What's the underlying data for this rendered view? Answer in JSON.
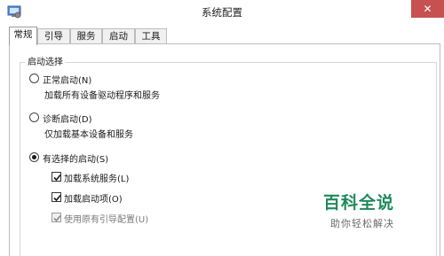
{
  "window": {
    "title": "系统配置",
    "close_glyph": "✕"
  },
  "tabs": [
    {
      "label": "常规",
      "active": true
    },
    {
      "label": "引导",
      "active": false
    },
    {
      "label": "服务",
      "active": false
    },
    {
      "label": "启动",
      "active": false
    },
    {
      "label": "工具",
      "active": false
    }
  ],
  "startup_group": {
    "legend": "启动选择",
    "options": [
      {
        "label": "正常启动(N)",
        "description": "加载所有设备驱动程序和服务",
        "selected": false
      },
      {
        "label": "诊断启动(D)",
        "description": "仅加载基本设备和服务",
        "selected": false
      },
      {
        "label": "有选择的启动(S)",
        "selected": true
      }
    ],
    "sub_options": [
      {
        "label": "加载系统服务(L)",
        "checked": true,
        "enabled": true
      },
      {
        "label": "加载启动项(O)",
        "checked": true,
        "enabled": true
      },
      {
        "label": "使用原有引导配置(U)",
        "checked": true,
        "enabled": false
      }
    ]
  },
  "watermark": {
    "main": "百科全说",
    "sub": "助你轻松解决"
  },
  "colors": {
    "close_button": "#c75050",
    "watermark": "#1f8a5c",
    "disabled_text": "#7a7a7a"
  }
}
